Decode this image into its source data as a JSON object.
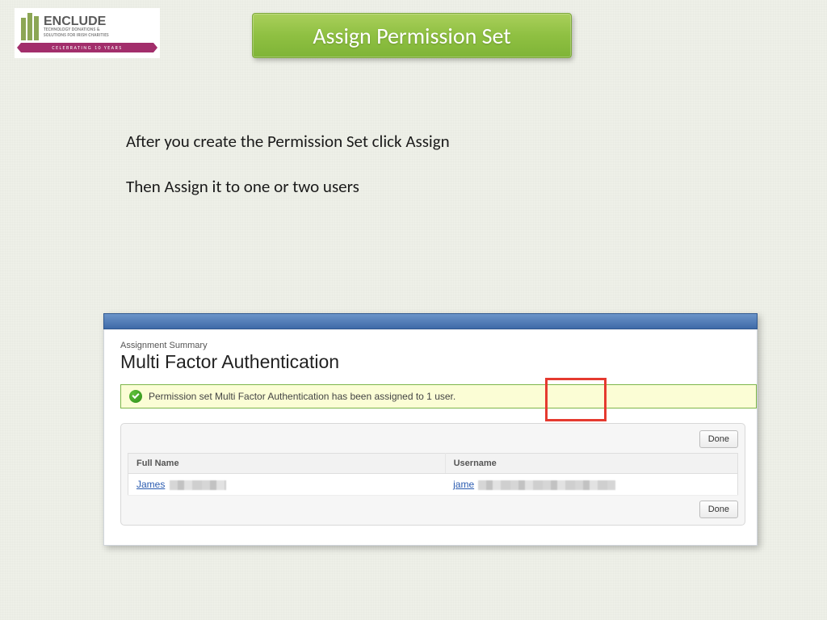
{
  "logo": {
    "brand": "ENCLUDE",
    "sub_l1": "TECHNOLOGY DONATIONS &",
    "sub_l2": "SOLUTIONS FOR IRISH CHARITIES",
    "ribbon": "CELEBRATING 10 YEARS"
  },
  "title": "Assign Permission Set",
  "instructions": {
    "line1": "After you create the Permission Set click Assign",
    "line2": "Then Assign it to one or two users"
  },
  "screenshot": {
    "summary_label": "Assignment Summary",
    "summary_title": "Multi Factor Authentication",
    "success_msg": "Permission set Multi Factor Authentication has been assigned to 1 user.",
    "done_label": "Done",
    "columns": {
      "full_name": "Full Name",
      "username": "Username"
    },
    "row": {
      "full_name_visible": "James",
      "username_visible": "jame"
    }
  }
}
